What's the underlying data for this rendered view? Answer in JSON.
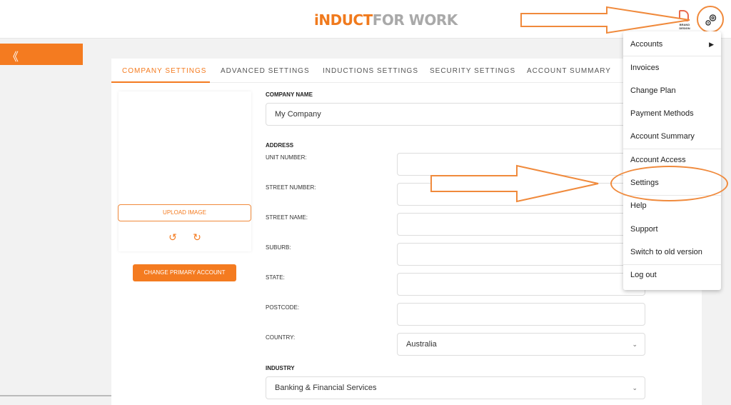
{
  "header": {
    "logo_part1": "iNDUCT",
    "logo_part2": "FOR WORK",
    "brand_mark_text": "BRAND DESIGN",
    "settings_icon": "gear-icon"
  },
  "sidebar": {
    "toggle_label": "《"
  },
  "tabs": [
    {
      "label": "COMPANY SETTINGS"
    },
    {
      "label": "ADVANCED SETTINGS"
    },
    {
      "label": "INDUCTIONS SETTINGS"
    },
    {
      "label": "SECURITY SETTINGS"
    },
    {
      "label": "ACCOUNT SUMMARY"
    }
  ],
  "image_panel": {
    "upload_label": "UPLOAD IMAGE",
    "rotate_left_icon": "rotate-left-icon",
    "rotate_right_icon": "rotate-right-icon",
    "primary_account_label": "CHANGE PRIMARY ACCOUNT"
  },
  "form": {
    "company_name_label": "COMPANY NAME",
    "company_name_value": "My Company",
    "address_label": "ADDRESS",
    "unit_number_label": "UNIT NUMBER:",
    "street_number_label": "STREET NUMBER:",
    "street_name_label": "STREET NAME:",
    "suburb_label": "SUBURB:",
    "state_label": "STATE:",
    "postcode_label": "POSTCODE:",
    "country_label": "COUNTRY:",
    "country_value": "Australia",
    "industry_label": "INDUSTRY",
    "industry_value": "Banking & Financial Services"
  },
  "menu": {
    "items": [
      {
        "label": "Accounts"
      },
      {
        "label": "Invoices"
      },
      {
        "label": "Change Plan"
      },
      {
        "label": "Payment Methods"
      },
      {
        "label": "Account Summary"
      },
      {
        "label": "Account Access"
      },
      {
        "label": "Settings"
      },
      {
        "label": "Help"
      },
      {
        "label": "Support"
      },
      {
        "label": "Switch to old version"
      },
      {
        "label": "Log out"
      }
    ]
  },
  "colors": {
    "accent": "#f47b20",
    "annotation": "#f08a3c"
  }
}
